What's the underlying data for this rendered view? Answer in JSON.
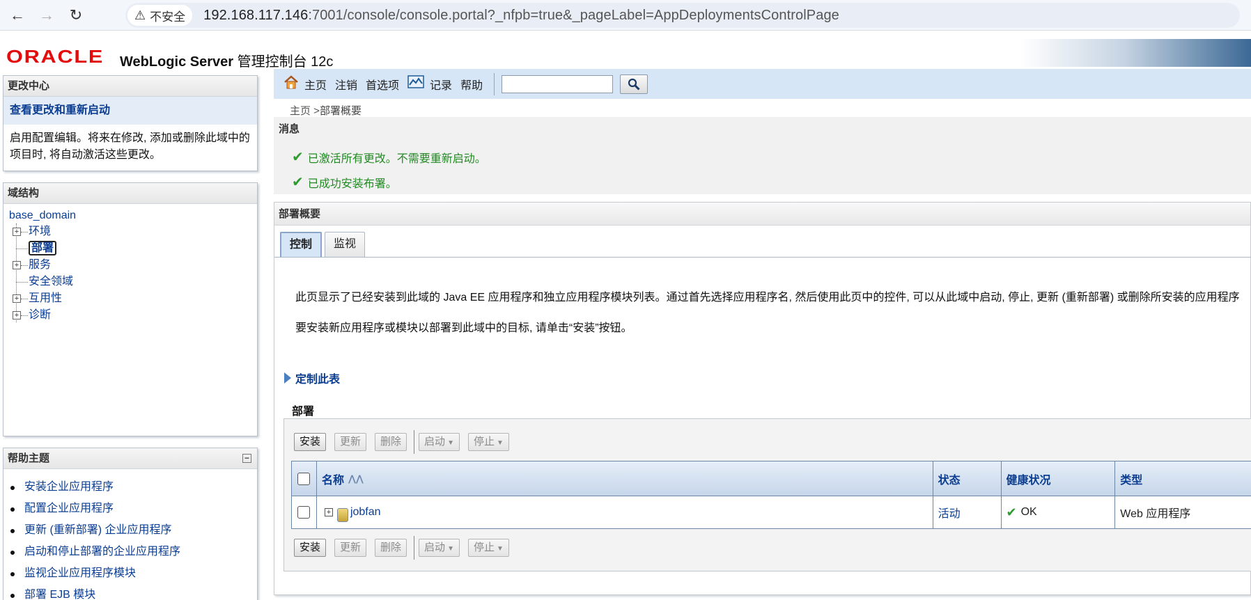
{
  "browser": {
    "security_label": "不安全",
    "url_host": "192.168.117.146",
    "url_path": ":7001/console/console.portal?_nfpb=true&_pageLabel=AppDeploymentsControlPage"
  },
  "header": {
    "logo_text": "ORACLE",
    "product_bold": "WebLogic Server",
    "product_rest": " 管理控制台 12c"
  },
  "change_center": {
    "title": "更改中心",
    "link": "查看更改和重新启动",
    "description": "启用配置编辑。将来在修改, 添加或删除此域中的项目时, 将自动激活这些更改。"
  },
  "domain_structure": {
    "title": "域结构",
    "root": "base_domain",
    "items": [
      {
        "label": "环境"
      },
      {
        "label": "部署"
      },
      {
        "label": "服务"
      },
      {
        "label": "安全领域"
      },
      {
        "label": "互用性"
      },
      {
        "label": "诊断"
      }
    ]
  },
  "help": {
    "title": "帮助主题",
    "collapse": "−",
    "items": [
      "安装企业应用程序",
      "配置企业应用程序",
      "更新 (重新部署) 企业应用程序",
      "启动和停止部署的企业应用程序",
      "监视企业应用程序模块",
      "部署 EJB 模块"
    ]
  },
  "toolbar": {
    "home": "主页",
    "logout": "注销",
    "preferences": "首选项",
    "record": "记录",
    "help": "帮助"
  },
  "breadcrumb": {
    "home": "主页",
    "separator": " >",
    "current": "部署概要"
  },
  "messages": {
    "title": "消息",
    "items": [
      "已激活所有更改。不需要重新启动。",
      "已成功安装布署。"
    ]
  },
  "content": {
    "title": "部署概要",
    "tabs": [
      "控制",
      "监视"
    ],
    "desc1": "此页显示了已经安装到此域的 Java EE 应用程序和独立应用程序模块列表。通过首先选择应用程序名, 然后使用此页中的控件, 可以从此域中启动, 停止, 更新 (重新部署) 或删除所安装的应用程序",
    "desc2": "要安装新应用程序或模块以部署到此域中的目标, 请单击“安装”按钮。",
    "customize": "定制此表",
    "deployments_label": "部署",
    "buttons": {
      "install": "安装",
      "update": "更新",
      "delete": "删除",
      "start": "启动",
      "stop": "停止"
    },
    "table": {
      "headers": [
        "名称",
        "状态",
        "健康状况",
        "类型"
      ],
      "rows": [
        {
          "name": "jobfan",
          "state": "活动",
          "health": "OK",
          "type": "Web 应用程序"
        }
      ]
    }
  }
}
